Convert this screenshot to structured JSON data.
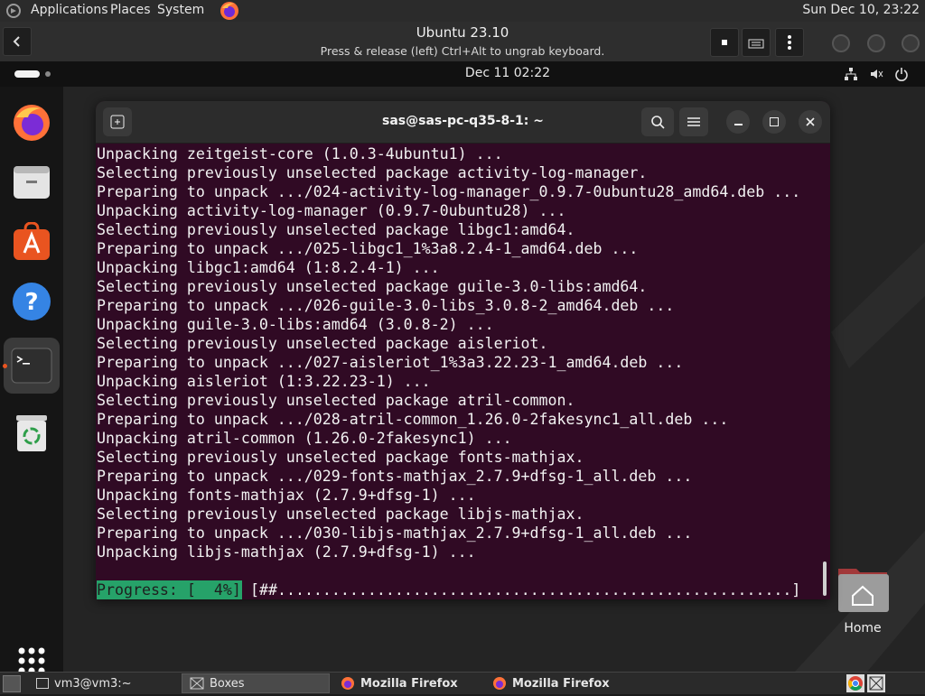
{
  "host_panel": {
    "menu": [
      "Applications",
      "Places",
      "System"
    ],
    "clock": "Sun Dec 10, 23:22"
  },
  "boxes": {
    "vm_title": "Ubuntu 23.10",
    "hint": "Press & release (left) Ctrl+Alt to ungrab keyboard."
  },
  "guest": {
    "clock": "Dec 11  02:22",
    "desktop_icon_label": "Home"
  },
  "terminal": {
    "title": "sas@sas-pc-q35-8-1: ~",
    "lines": [
      "Unpacking zeitgeist-core (1.0.3-4ubuntu1) ...",
      "Selecting previously unselected package activity-log-manager.",
      "Preparing to unpack .../024-activity-log-manager_0.9.7-0ubuntu28_amd64.deb ...",
      "Unpacking activity-log-manager (0.9.7-0ubuntu28) ...",
      "Selecting previously unselected package libgc1:amd64.",
      "Preparing to unpack .../025-libgc1_1%3a8.2.4-1_amd64.deb ...",
      "Unpacking libgc1:amd64 (1:8.2.4-1) ...",
      "Selecting previously unselected package guile-3.0-libs:amd64.",
      "Preparing to unpack .../026-guile-3.0-libs_3.0.8-2_amd64.deb ...",
      "Unpacking guile-3.0-libs:amd64 (3.0.8-2) ...",
      "Selecting previously unselected package aisleriot.",
      "Preparing to unpack .../027-aisleriot_1%3a3.22.23-1_amd64.deb ...",
      "Unpacking aisleriot (1:3.22.23-1) ...",
      "Selecting previously unselected package atril-common.",
      "Preparing to unpack .../028-atril-common_1.26.0-2fakesync1_all.deb ...",
      "Unpacking atril-common (1.26.0-2fakesync1) ...",
      "Selecting previously unselected package fonts-mathjax.",
      "Preparing to unpack .../029-fonts-mathjax_2.7.9+dfsg-1_all.deb ...",
      "Unpacking fonts-mathjax (2.7.9+dfsg-1) ...",
      "Selecting previously unselected package libjs-mathjax.",
      "Preparing to unpack .../030-libjs-mathjax_2.7.9+dfsg-1_all.deb ...",
      "Unpacking libjs-mathjax (2.7.9+dfsg-1) ..."
    ],
    "progress_label": "Progress: [  4%]",
    "progress_bar": "[##.........................................................]",
    "progress_percent": 4
  },
  "taskbar": {
    "tasks": [
      "vm3@vm3:~",
      "Boxes",
      "Mozilla Firefox",
      "Mozilla Firefox"
    ]
  },
  "colors": {
    "terminal_bg": "#300a24",
    "progress_bg": "#26a269",
    "ubuntu_orange": "#e95420"
  },
  "icons": [
    "firefox-icon",
    "files-icon",
    "app-center-icon",
    "help-icon",
    "terminal-icon",
    "trash-icon",
    "app-grid-icon",
    "home-folder-icon"
  ]
}
